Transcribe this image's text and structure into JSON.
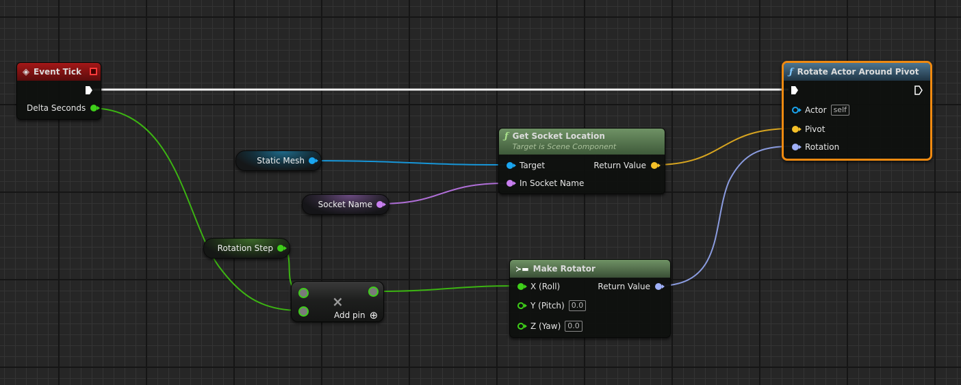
{
  "colors": {
    "exec": "#ffffff",
    "float": "#3fcf1a",
    "object": "#1aa6f0",
    "vector": "#f5c028",
    "name": "#c87ff0",
    "rotator": "#9fb0f8",
    "event_header": "#8a1212",
    "function_header": "#3c5f75",
    "pure_header": "#5a7c52",
    "selected_outline": "#f08a10"
  },
  "nodes": {
    "event_tick": {
      "title": "Event Tick",
      "icon": "event-diamond-icon",
      "pins": {
        "delta_seconds": "Delta Seconds"
      }
    },
    "rotate_actor": {
      "title": "Rotate Actor Around Pivot",
      "icon": "function-icon",
      "selected": true,
      "pins": {
        "actor": "Actor",
        "actor_default": "self",
        "pivot": "Pivot",
        "rotation": "Rotation"
      }
    },
    "get_socket_location": {
      "title": "Get Socket Location",
      "subtitle": "Target is Scene Component",
      "icon": "function-icon",
      "pins": {
        "target": "Target",
        "in_socket_name": "In Socket Name",
        "return_value": "Return Value"
      }
    },
    "make_rotator": {
      "title": "Make Rotator",
      "icon": "make-struct-icon",
      "pins": {
        "x": "X (Roll)",
        "y": "Y (Pitch)",
        "y_default": "0.0",
        "z": "Z (Yaw)",
        "z_default": "0.0",
        "return_value": "Return Value"
      }
    },
    "add": {
      "symbol": "×",
      "add_pin_label": "Add pin",
      "add_pin_icon": "⊕"
    }
  },
  "variables": {
    "static_mesh": "Static Mesh",
    "socket_name": "Socket Name",
    "rotation_step": "Rotation Step"
  }
}
